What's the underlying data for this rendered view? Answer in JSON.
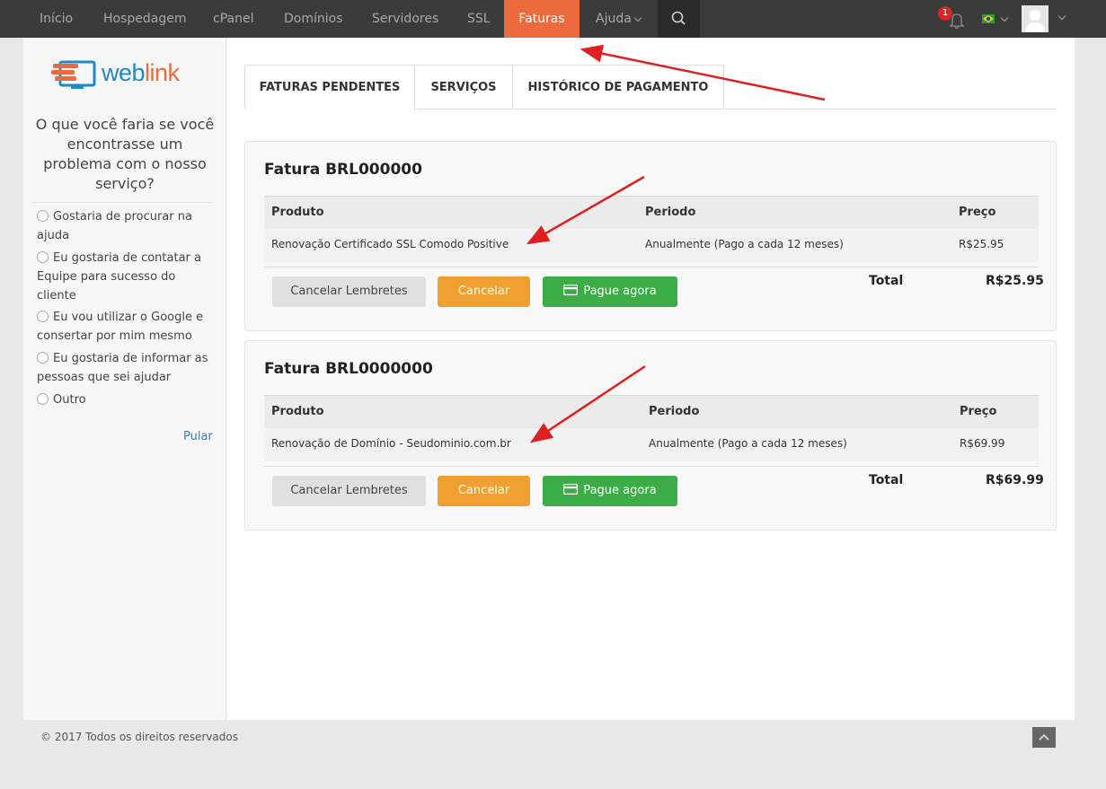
{
  "nav": {
    "items": [
      "Início",
      "Hospedagem",
      "cPanel",
      "Domínios",
      "Servidores",
      "SSL",
      "Faturas",
      "Ajuda"
    ],
    "active": "Faturas",
    "notification_count": "1"
  },
  "brand": {
    "logo_text_a": "web",
    "logo_text_b": "link"
  },
  "survey": {
    "question": "O que você faria se você encontrasse um problema com o nosso serviço?",
    "options": [
      "Gostaria de procurar na ajuda",
      "Eu gostaria de contatar a Equipe para sucesso do cliente",
      "Eu vou utilizar o Google e consertar por mim mesmo",
      "Eu gostaria de informar as pessoas que sei ajudar",
      "Outro"
    ],
    "skip_label": "Pular"
  },
  "tabs": [
    "FATURAS PENDENTES",
    "SERVIÇOS",
    "HISTÓRICO DE PAGAMENTO"
  ],
  "table_headers": {
    "product": "Produto",
    "period": "Periodo",
    "price": "Preço"
  },
  "invoices": [
    {
      "title": "Fatura BRL000000",
      "product": "Renovação Certificado SSL Comodo Positive",
      "period": "Anualmente (Pago a cada 12 meses)",
      "price": "R$25.95",
      "total_label": "Total",
      "total": "R$25.95"
    },
    {
      "title": "Fatura BRL0000000",
      "product": "Renovação de Domínio - Seudominio.com.br",
      "period": "Anualmente (Pago a cada 12 meses)",
      "price": "R$69.99",
      "total_label": "Total",
      "total": "R$69.99"
    }
  ],
  "buttons": {
    "cancel_reminders": "Cancelar Lembretes",
    "cancel": "Cancelar",
    "pay_now": "Pague agora"
  },
  "footer": {
    "copyright": "© 2017 Todos os direitos reservados"
  },
  "colors": {
    "nav_bg": "#3b3b3b",
    "accent": "#ec6a3c",
    "green": "#3cac46",
    "orange": "#f0a030",
    "annotation": "#e02020"
  }
}
